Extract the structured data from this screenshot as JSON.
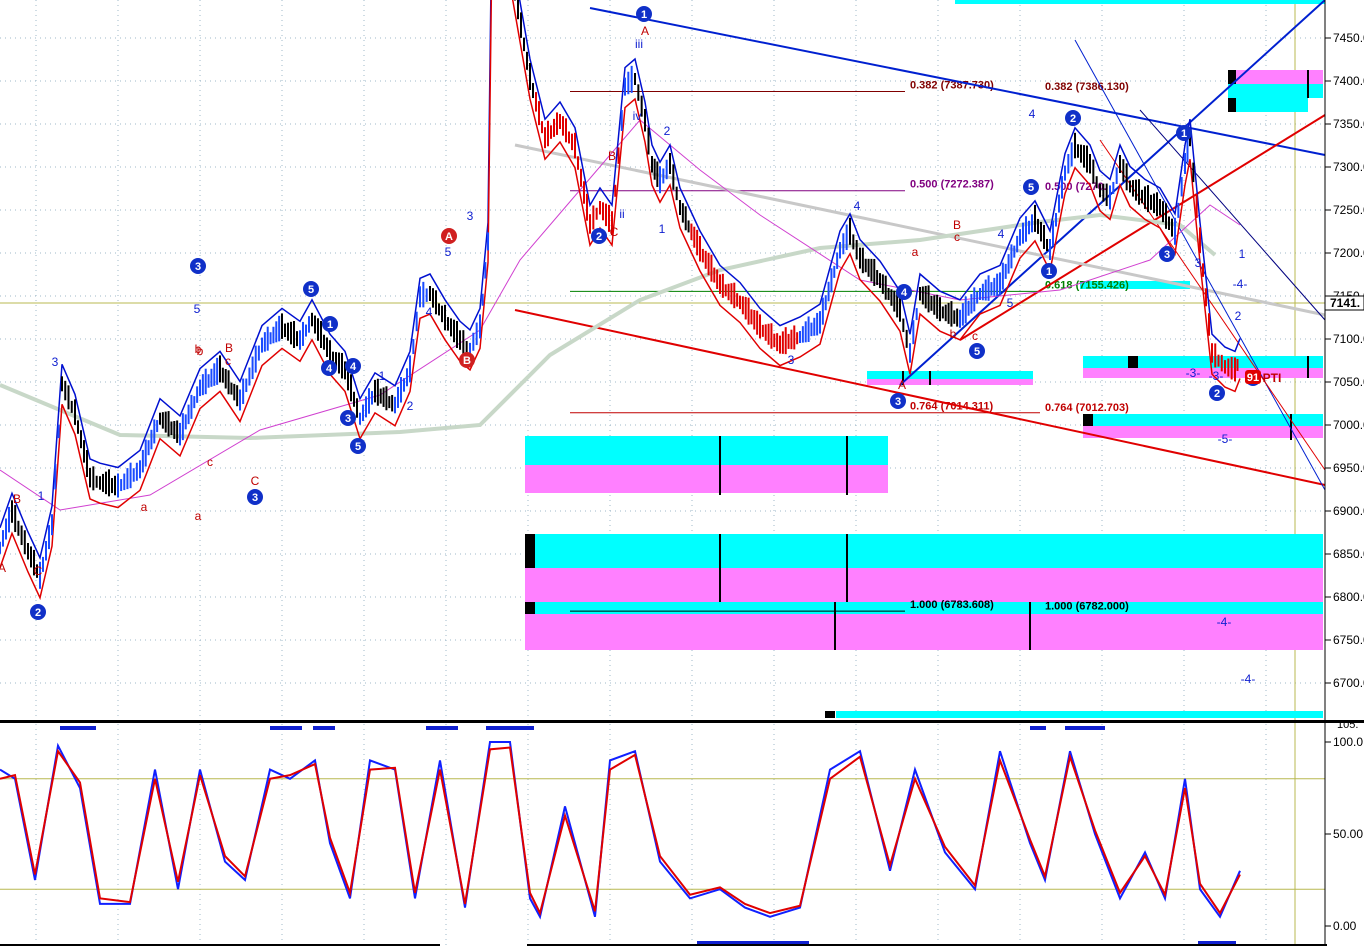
{
  "chart_data": [
    {
      "type": "candlestick",
      "panel": "price",
      "yticks": [
        "7450.00",
        "7400.00",
        "7350.00",
        "7300.00",
        "7250.00",
        "7200.00",
        "7150.00",
        "7100.00",
        "7050.00",
        "7000.00",
        "6950.00",
        "6900.00",
        "6850.00",
        "6800.00",
        "6750.00",
        "6700.00"
      ],
      "ylim": [
        6665,
        7485
      ],
      "last_price_label": "7141.",
      "grid": true,
      "price_path_x": [
        0,
        12,
        28,
        40,
        52,
        62,
        75,
        90,
        100,
        118,
        140,
        160,
        180,
        200,
        220,
        240,
        262,
        282,
        300,
        312,
        330,
        345,
        360,
        375,
        395,
        410,
        420,
        430,
        445,
        460,
        470,
        480,
        488,
        492,
        500,
        515,
        530,
        545,
        560,
        575,
        590,
        600,
        612,
        625,
        635,
        645,
        652,
        660,
        670,
        680,
        700,
        720,
        740,
        760,
        780,
        800,
        820,
        840,
        850,
        860,
        880,
        900,
        910,
        920,
        940,
        960,
        980,
        1000,
        1020,
        1035,
        1050,
        1065,
        1075,
        1090,
        1100,
        1110,
        1120,
        1130,
        1145,
        1160,
        1175,
        1185,
        1190,
        1200,
        1212,
        1225,
        1235,
        1240
      ],
      "price_path_y": [
        6855,
        6895,
        6850,
        6820,
        6880,
        7045,
        7010,
        6935,
        6930,
        6925,
        6945,
        7005,
        6985,
        7040,
        7060,
        7025,
        7090,
        7110,
        7095,
        7120,
        7080,
        7060,
        7005,
        7035,
        7020,
        7060,
        7145,
        7150,
        7120,
        7095,
        7085,
        7110,
        7210,
        7580,
        7600,
        7500,
        7400,
        7330,
        7350,
        7320,
        7230,
        7250,
        7230,
        7390,
        7400,
        7350,
        7300,
        7280,
        7300,
        7250,
        7200,
        7160,
        7140,
        7110,
        7090,
        7100,
        7115,
        7200,
        7220,
        7190,
        7165,
        7130,
        7080,
        7150,
        7130,
        7120,
        7150,
        7160,
        7215,
        7235,
        7200,
        7290,
        7320,
        7300,
        7270,
        7260,
        7300,
        7275,
        7260,
        7250,
        7220,
        7300,
        7330,
        7210,
        7080,
        7065,
        7060,
        7075
      ],
      "fib_levels": [
        {
          "label": "0.382 (7387.730)",
          "value": 7387.73
        },
        {
          "label": "0.382 (7386.130)",
          "value": 7386.13
        },
        {
          "label": "0.500 (7272.387)",
          "value": 7272.387
        },
        {
          "label": "0.500 (7270.",
          "value": 7270.0
        },
        {
          "label": "0.618 (7155.426)",
          "value": 7155.426
        },
        {
          "label": "0.764 (7014.311)",
          "value": 7014.311
        },
        {
          "label": "0.764 (7012.703)",
          "value": 7012.703
        },
        {
          "label": "1.000 (6783.608)",
          "value": 6783.608
        },
        {
          "label": "1.000 (6782.000)",
          "value": 6782.0
        }
      ],
      "wave_labels": {
        "circled_blue": [
          "2",
          "3",
          "5",
          "1",
          "4",
          "3",
          "5",
          "4",
          "3",
          "1",
          "2",
          "3",
          "4",
          "5",
          "5",
          "1",
          "2",
          "3",
          "1",
          "2",
          "3"
        ],
        "circled_red": [
          "A",
          "B"
        ],
        "text_blue": [
          "3",
          "1",
          "5",
          "iii",
          "iv",
          "ii",
          "1",
          "2",
          "4",
          "3",
          "5",
          "4",
          "1",
          "2",
          "3",
          "4",
          "5",
          "-3-",
          "-3-",
          "-5-",
          "-4-",
          "-4-",
          "-4-",
          "1",
          "2",
          "4",
          "3"
        ],
        "text_red": [
          "B",
          "C",
          "a",
          "b",
          "c",
          "B",
          "C",
          "A",
          "A",
          "a",
          "b",
          "c",
          "C",
          "B",
          "c",
          "a",
          "b",
          "c",
          "A",
          "B",
          "PTI"
        ],
        "circled_red_badge": "91"
      },
      "colors": {
        "up_wick": "#1a4bff",
        "down_wick": "#000000",
        "red_band": "#e00000",
        "blue_band": "#0010d0",
        "ma_grey": "#c8d8c8",
        "cyan": "#00ffff",
        "magenta": "#ff80ff",
        "olive": "#b8b850"
      }
    },
    {
      "type": "line",
      "panel": "oscillator",
      "yticks": [
        "100.0",
        "50.00",
        "0.00"
      ],
      "ylim": [
        0,
        100
      ],
      "top_cut_label": "105.",
      "series": [
        {
          "color": "#1020ff",
          "x": [
            0,
            15,
            35,
            58,
            80,
            100,
            130,
            155,
            178,
            200,
            225,
            245,
            270,
            290,
            315,
            330,
            350,
            370,
            395,
            415,
            440,
            465,
            490,
            510,
            530,
            540,
            565,
            595,
            610,
            635,
            660,
            690,
            720,
            745,
            770,
            800,
            830,
            860,
            890,
            915,
            945,
            975,
            1000,
            1030,
            1045,
            1070,
            1095,
            1120,
            1145,
            1165,
            1185,
            1200,
            1220,
            1240
          ],
          "y": [
            85,
            80,
            25,
            98,
            75,
            12,
            12,
            85,
            20,
            85,
            35,
            25,
            85,
            80,
            90,
            45,
            15,
            90,
            85,
            15,
            90,
            10,
            100,
            100,
            15,
            5,
            65,
            5,
            90,
            95,
            35,
            15,
            20,
            10,
            5,
            10,
            85,
            95,
            30,
            85,
            40,
            20,
            95,
            45,
            25,
            95,
            50,
            15,
            40,
            15,
            80,
            20,
            5,
            30
          ]
        },
        {
          "color": "#e00000",
          "x": [
            0,
            15,
            35,
            58,
            80,
            100,
            130,
            155,
            178,
            200,
            225,
            245,
            270,
            290,
            315,
            330,
            350,
            370,
            395,
            415,
            440,
            465,
            490,
            510,
            530,
            540,
            565,
            595,
            610,
            635,
            660,
            690,
            720,
            745,
            770,
            800,
            830,
            860,
            890,
            915,
            945,
            975,
            1000,
            1030,
            1045,
            1070,
            1095,
            1120,
            1145,
            1165,
            1185,
            1200,
            1220,
            1240
          ],
          "y": [
            80,
            82,
            28,
            95,
            78,
            15,
            13,
            80,
            24,
            82,
            38,
            27,
            80,
            82,
            88,
            48,
            18,
            85,
            86,
            18,
            85,
            12,
            96,
            97,
            18,
            7,
            60,
            8,
            85,
            93,
            38,
            17,
            21,
            12,
            7,
            11,
            80,
            92,
            33,
            80,
            43,
            22,
            90,
            47,
            27,
            92,
            52,
            18,
            38,
            17,
            75,
            23,
            7,
            28
          ]
        }
      ]
    }
  ]
}
